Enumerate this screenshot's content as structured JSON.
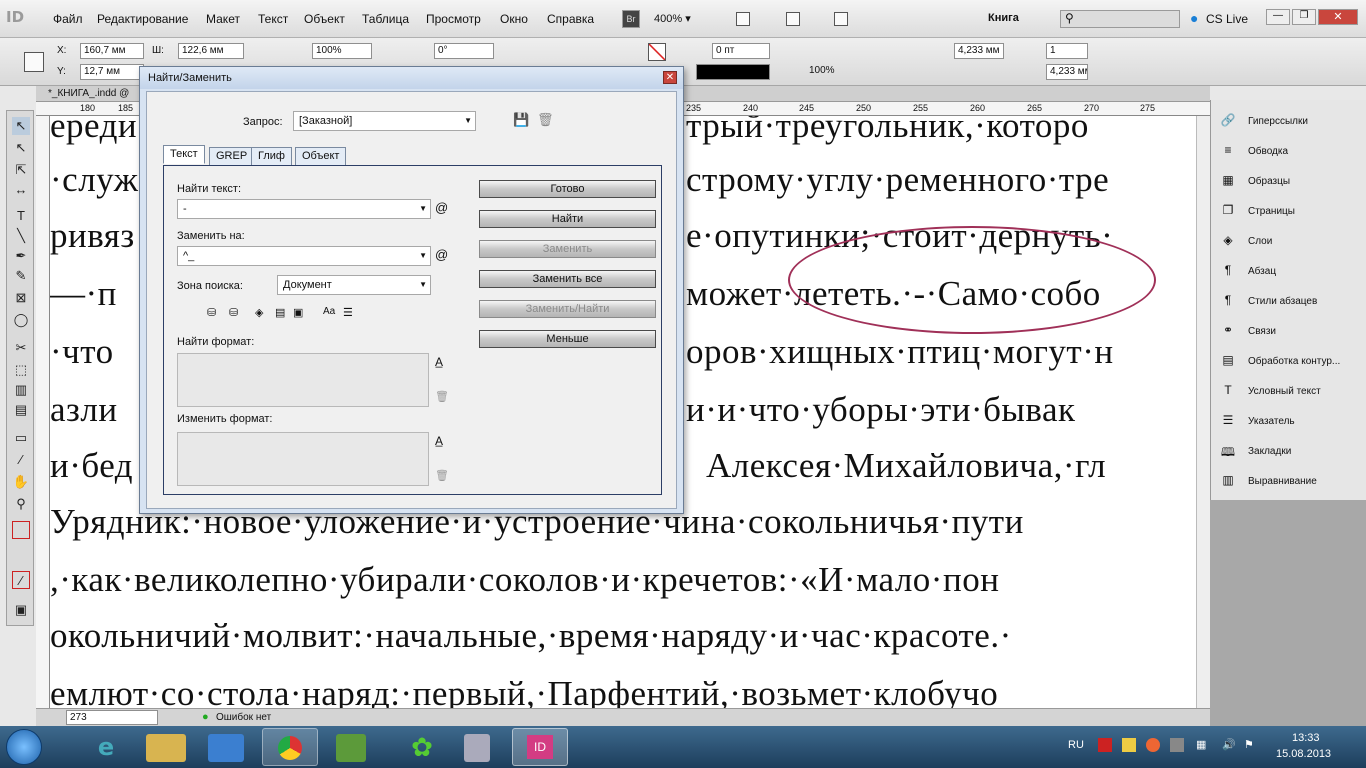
{
  "menubar": {
    "logo": "ID",
    "items": [
      "Файл",
      "Редактирование",
      "Макет",
      "Текст",
      "Объект",
      "Таблица",
      "Просмотр",
      "Окно",
      "Справка"
    ],
    "br": "Br",
    "zoom": "400%",
    "workspace": "Книга",
    "cslive": "CS Live"
  },
  "control": {
    "x_label": "X:",
    "x_value": "160,7 мм",
    "y_label": "Y:",
    "y_value": "12,7 мм",
    "w_label": "Ш:",
    "w_value": "122,6 мм",
    "h_label": "В:",
    "h_value": "",
    "scale1": "100%",
    "scale2": "100%",
    "angle": "0°",
    "stroke": "0 пт",
    "pct": "100%",
    "dim1": "4,233 мм",
    "cols": "1",
    "dim2": "4,233 мм"
  },
  "doc": {
    "tab": "*_КНИГА_.indd @",
    "ruler_left": [
      "180",
      "185"
    ],
    "ruler_right": [
      "235",
      "240",
      "245",
      "250",
      "255",
      "260",
      "265",
      "270",
      "275"
    ]
  },
  "text_lines": [
    "ереди",
    "·служ",
    "ривяз",
    "—·п",
    "·что",
    "азли",
    "и·бед",
    "Урядник:·новое·уложение·и·устроение·чина·сокольничья·пути",
    ",·как·великолепно·убирали·соколов·и·кречетов:·«И·мало·пон",
    "окольничий·молвит:·начальные,·время·наряду·и·час·красоте.·",
    "емлют·со·стола·наряд:·первый,·Парфентий,·возьмет·клобучо"
  ],
  "text_right": [
    "трый·треугольник,·которо",
    "строму·углу·ременного·тре",
    "е·опутинки;·стоит·дернуть·",
    "может·лететь.·-·Само·собо",
    "оров·хищных·птиц·могут·н",
    "и·и·что·уборы·эти·бывак",
    "Алексея·Михайловича,·гл"
  ],
  "status": {
    "page": "273",
    "errors": "Ошибок нет"
  },
  "panels": [
    {
      "icon": "hyperlinks-icon",
      "label": "Гиперссылки"
    },
    {
      "icon": "stroke-icon",
      "label": "Обводка"
    },
    {
      "icon": "swatches-icon",
      "label": "Образцы"
    },
    {
      "icon": "pages-icon",
      "label": "Страницы"
    },
    {
      "icon": "layers-icon",
      "label": "Слои"
    },
    {
      "icon": "paragraph-icon",
      "label": "Абзац"
    },
    {
      "icon": "paragraph-styles-icon",
      "label": "Стили абзацев"
    },
    {
      "icon": "links-icon",
      "label": "Связи"
    },
    {
      "icon": "text-wrap-icon",
      "label": "Обработка контур..."
    },
    {
      "icon": "conditional-text-icon",
      "label": "Условный текст"
    },
    {
      "icon": "index-icon",
      "label": "Указатель"
    },
    {
      "icon": "bookmarks-icon",
      "label": "Закладки"
    },
    {
      "icon": "align-icon",
      "label": "Выравнивание"
    }
  ],
  "dialog": {
    "title": "Найти/Заменить",
    "query_label": "Запрос:",
    "query_value": "[Заказной]",
    "tabs": [
      "Текст",
      "GREP",
      "Глиф",
      "Объект"
    ],
    "find_label": "Найти текст:",
    "find_value": "-",
    "replace_label": "Заменить на:",
    "replace_value": "^_",
    "search_label": "Зона поиска:",
    "search_value": "Документ",
    "find_format_label": "Найти формат:",
    "change_format_label": "Изменить формат:",
    "buttons": [
      "Готово",
      "Найти",
      "Заменить",
      "Заменить все",
      "Заменить/Найти",
      "Меньше"
    ]
  },
  "taskbar": {
    "lang": "RU",
    "time": "13:33",
    "date": "15.08.2013",
    "id_label": "ID"
  }
}
